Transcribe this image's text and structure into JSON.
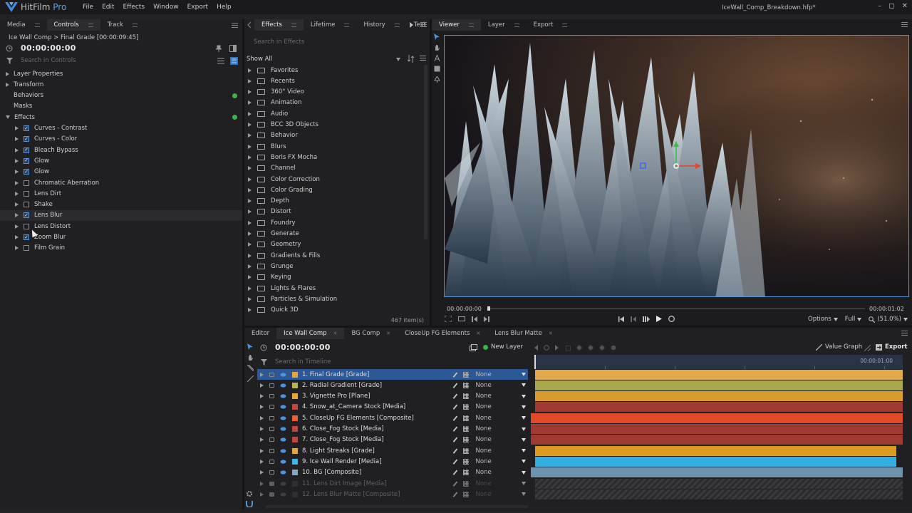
{
  "app": {
    "brand": "HitFilm",
    "edition": "Pro",
    "file_title": "IceWall_Comp_Breakdown.hfp*"
  },
  "menu": [
    "File",
    "Edit",
    "Effects",
    "Window",
    "Export",
    "Help"
  ],
  "window_controls": {
    "minimize": "–",
    "maximize": "◻",
    "close": "✕"
  },
  "left_panel": {
    "tabs": [
      "Media",
      "Controls",
      "Track"
    ],
    "breadcrumb": "Ice Wall Comp > Final Grade [00:00:09:45]",
    "timecode": "00:00:00:00",
    "search_placeholder": "Search in Controls",
    "sections": [
      {
        "label": "Layer Properties",
        "arrow": true,
        "plus": false
      },
      {
        "label": "Transform",
        "arrow": true,
        "plus": false
      },
      {
        "label": "Behaviors",
        "arrow": false,
        "plus": true
      },
      {
        "label": "Masks",
        "arrow": false,
        "plus": false
      },
      {
        "label": "Effects",
        "arrow": true,
        "open": true,
        "plus": true
      }
    ],
    "effects": [
      {
        "label": "Curves - Contrast",
        "checked": true
      },
      {
        "label": "Curves - Color",
        "checked": true
      },
      {
        "label": "Bleach Bypass",
        "checked": true
      },
      {
        "label": "Glow",
        "checked": true
      },
      {
        "label": "Glow",
        "checked": true
      },
      {
        "label": "Chromatic Aberration",
        "checked": false
      },
      {
        "label": "Lens Dirt",
        "checked": false
      },
      {
        "label": "Shake",
        "checked": false
      },
      {
        "label": "Lens Blur",
        "checked": true,
        "hover": true
      },
      {
        "label": "Lens Distort",
        "checked": false
      },
      {
        "label": "Zoom Blur",
        "checked": true
      },
      {
        "label": "Film Grain",
        "checked": false
      }
    ]
  },
  "effects_panel": {
    "tabs": [
      "Effects",
      "Lifetime",
      "History",
      "Text"
    ],
    "search_placeholder": "Search in Effects",
    "filter": "Show All",
    "folders": [
      "Favorites",
      "Recents",
      "360° Video",
      "Animation",
      "Audio",
      "BCC 3D Objects",
      "Behavior",
      "Blurs",
      "Boris FX Mocha",
      "Channel",
      "Color Correction",
      "Color Grading",
      "Depth",
      "Distort",
      "Foundry",
      "Generate",
      "Geometry",
      "Gradients & Fills",
      "Grunge",
      "Keying",
      "Lights & Flares",
      "Particles & Simulation",
      "Quick 3D"
    ],
    "item_count": "467 item(s)"
  },
  "viewer": {
    "tabs": [
      "Viewer",
      "Layer",
      "Export"
    ],
    "time_start": "00:00:00:00",
    "time_end": "00:00:01:02",
    "options_label": "Options",
    "quality_label": "Full",
    "zoom_label": "(51.0%)"
  },
  "timeline": {
    "tabs": [
      {
        "label": "Editor",
        "closable": false
      },
      {
        "label": "Ice Wall Comp",
        "closable": true,
        "active": true
      },
      {
        "label": "BG Comp",
        "closable": true
      },
      {
        "label": "CloseUp FG Elements",
        "closable": true
      },
      {
        "label": "Lens Blur Matte",
        "closable": true
      }
    ],
    "timecode": "00:00:00:00",
    "new_layer_label": "New Layer",
    "value_graph_label": "Value Graph",
    "export_label": "Export",
    "search_placeholder": "Search in Timeline",
    "ruler_end": "00:00:01:00",
    "layers": [
      {
        "name": "1. Final Grade [Grade]",
        "color": "#e8a33c",
        "blend": "None",
        "bar": "#e2a94a",
        "selected": true
      },
      {
        "name": "2. Radial Gradient [Grade]",
        "color": "#b7b552",
        "blend": "None",
        "bar": "#a9a84f"
      },
      {
        "name": "3. Vignette Pro [Plane]",
        "color": "#e8a33c",
        "blend": "None",
        "bar": "#d89b2e"
      },
      {
        "name": "4. Snow_at_Camera Stock [Media]",
        "color": "#c0463e",
        "blend": "None",
        "bar": "#9e3a32"
      },
      {
        "name": "5. CloseUp FG Elements [Composite]",
        "color": "#ef5d32",
        "blend": "None",
        "bar": "#e04a28"
      },
      {
        "name": "6. Close_Fog Stock [Media]",
        "color": "#c0463e",
        "blend": "None",
        "bar": "#9e3a32"
      },
      {
        "name": "7. Close_Fog Stock [Media]",
        "color": "#c0463e",
        "blend": "None",
        "bar": "#9e3a32"
      },
      {
        "name": "8. Light Streaks [Grade]",
        "color": "#e8a33c",
        "blend": "None",
        "bar": "#dc9a1e"
      },
      {
        "name": "9. Ice Wall Render [Media]",
        "color": "#3fb6e8",
        "blend": "None",
        "bar": "#32aee0"
      },
      {
        "name": "10. BG [Composite]",
        "color": "#87a7c0",
        "blend": "None",
        "bar": "#6d93ad"
      },
      {
        "name": "11. Lens Dirt Image [Media]",
        "color": "#3a3a3a",
        "blend": "None",
        "bar": "hatch",
        "disabled": true
      },
      {
        "name": "12. Lens Blur Matte [Composite]",
        "color": "#3a3a3a",
        "blend": "None",
        "bar": "hatch",
        "disabled": true
      }
    ]
  }
}
